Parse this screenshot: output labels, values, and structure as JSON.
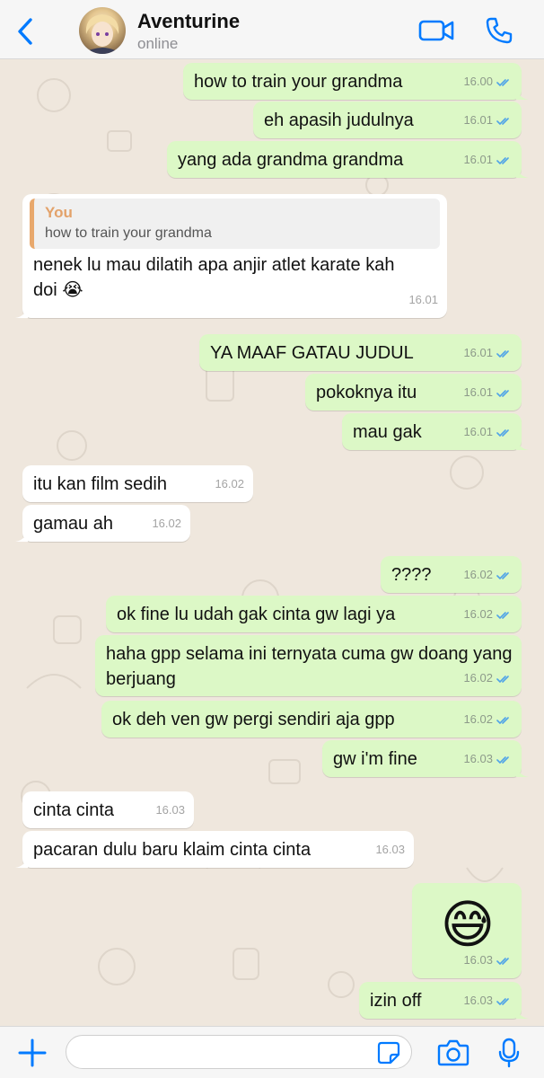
{
  "header": {
    "contact_name": "Aventurine",
    "status": "online",
    "icons": {
      "back": "chevron-left-icon",
      "video": "video-camera-icon",
      "call": "phone-icon"
    }
  },
  "messages": [
    {
      "dir": "out",
      "text": "how to train your grandma",
      "time": "16.00",
      "read": true
    },
    {
      "dir": "out",
      "text": "eh apasih judulnya",
      "time": "16.01",
      "read": true
    },
    {
      "dir": "out",
      "text": "yang ada grandma grandma",
      "time": "16.01",
      "read": true
    },
    {
      "dir": "in",
      "quote_name": "You",
      "quote_text": "how to train your grandma",
      "text": "nenek lu mau dilatih apa anjir atlet karate kah doi 😭",
      "time": "16.01"
    },
    {
      "dir": "out",
      "text": "YA MAAF GATAU JUDUL",
      "time": "16.01",
      "read": true
    },
    {
      "dir": "out",
      "text": "pokoknya itu",
      "time": "16.01",
      "read": true
    },
    {
      "dir": "out",
      "text": "mau gak",
      "time": "16.01",
      "read": true
    },
    {
      "dir": "in",
      "text": "itu kan film sedih",
      "time": "16.02"
    },
    {
      "dir": "in",
      "text": "gamau ah",
      "time": "16.02"
    },
    {
      "dir": "out",
      "text": "????",
      "time": "16.02",
      "read": true
    },
    {
      "dir": "out",
      "text": "ok fine lu udah gak cinta gw lagi ya",
      "time": "16.02",
      "read": true
    },
    {
      "dir": "out",
      "text": "haha gpp selama ini ternyata cuma gw doang yang berjuang",
      "time": "16.02",
      "read": true
    },
    {
      "dir": "out",
      "text": "ok deh ven gw pergi sendiri aja gpp",
      "time": "16.02",
      "read": true
    },
    {
      "dir": "out",
      "text": "gw i'm fine",
      "time": "16.03",
      "read": true
    },
    {
      "dir": "in",
      "text": "cinta cinta",
      "time": "16.03"
    },
    {
      "dir": "in",
      "text": "pacaran dulu baru klaim cinta cinta",
      "time": "16.03"
    },
    {
      "dir": "out",
      "text": "😅",
      "time": "16.03",
      "read": true
    },
    {
      "dir": "out",
      "text": "izin off",
      "time": "16.03",
      "read": true
    }
  ],
  "input_bar": {
    "placeholder": "",
    "icons": {
      "add": "plus-icon",
      "sticker": "sticker-icon",
      "camera": "camera-icon",
      "mic": "microphone-icon"
    }
  },
  "colors": {
    "accent": "#007aff",
    "outgoing_bubble": "#dcf8c6",
    "incoming_bubble": "#ffffff",
    "read_ticks": "#4fa3e8",
    "quote_name": "#e3a26a",
    "chat_background": "#efe7dd"
  }
}
